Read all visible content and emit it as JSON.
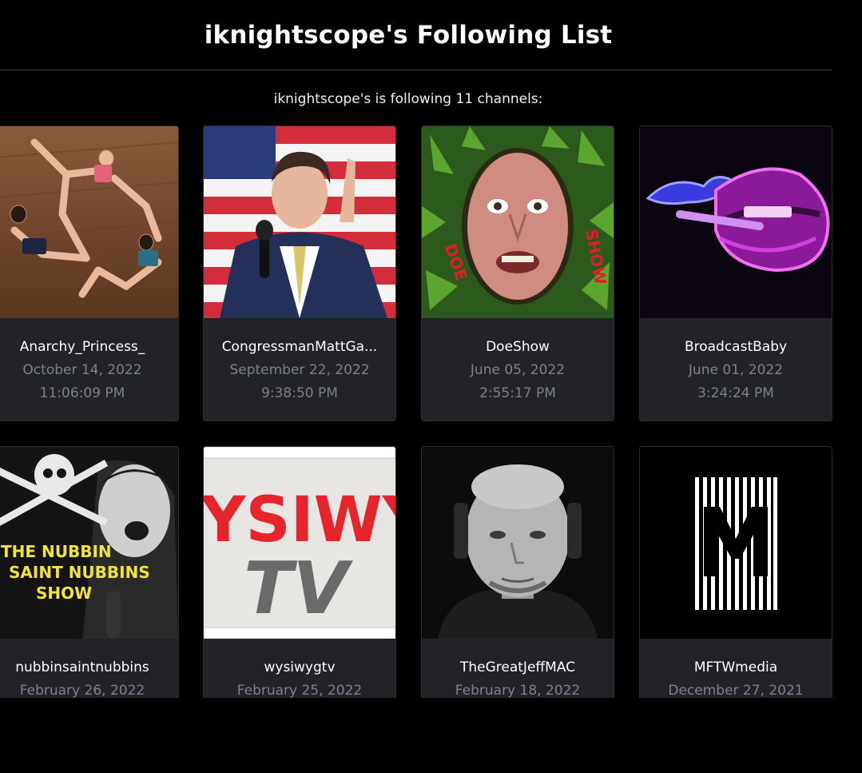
{
  "page": {
    "title": "iknightscope's Following List",
    "subtitle": "iknightscope's is following 11 channels:"
  },
  "channels": [
    {
      "name": "Anarchy_Princess_",
      "date": "October 14, 2022",
      "time": "11:06:09 PM",
      "thumb_icon": "dancers-photo"
    },
    {
      "name": "CongressmanMattGa...",
      "date": "September 22, 2022",
      "time": "9:38:50 PM",
      "thumb_icon": "speaker-flag-photo"
    },
    {
      "name": "DoeShow",
      "date": "June 05, 2022",
      "time": "2:55:17 PM",
      "thumb_icon": "doe-show-logo",
      "thumb_text_left": "DOE",
      "thumb_text_right": "SHOW"
    },
    {
      "name": "BroadcastBaby",
      "date": "June 01, 2022",
      "time": "3:24:24 PM",
      "thumb_icon": "neon-lips-art"
    },
    {
      "name": "nubbinsaintnubbins",
      "date": "February 26, 2022",
      "time": "",
      "thumb_icon": "nubbin-show-art",
      "thumb_lines": [
        "THE NUBBIN",
        "SAINT NUBBINS",
        "SHOW"
      ]
    },
    {
      "name": "wysiwygtv",
      "date": "February 25, 2022",
      "time": "",
      "thumb_icon": "wysiwyg-tv-logo",
      "thumb_lines": [
        "YSIWY",
        "TV"
      ]
    },
    {
      "name": "TheGreatJeffMAC",
      "date": "February 18, 2022",
      "time": "",
      "thumb_icon": "portrait-photo"
    },
    {
      "name": "MFTWmedia",
      "date": "December 27, 2021",
      "time": "",
      "thumb_icon": "m-stripes-logo"
    }
  ],
  "colors": {
    "background": "#000000",
    "card": "#212327",
    "muted_text": "#7c8189",
    "divider": "#3c3f44"
  }
}
